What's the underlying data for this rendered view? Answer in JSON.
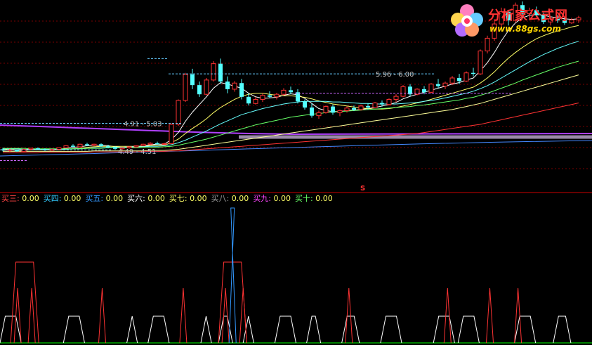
{
  "chart_data": [
    {
      "type": "candlestick",
      "price_labels": [
        "4.91 - 5.03",
        "4.49 - 4.51",
        "5.96 - 6.00"
      ],
      "marker": "S",
      "candles": [
        [
          4.52,
          4.55,
          4.48,
          4.5
        ],
        [
          4.5,
          4.53,
          4.47,
          4.51
        ],
        [
          4.51,
          4.52,
          4.47,
          4.48
        ],
        [
          4.48,
          4.53,
          4.47,
          4.52
        ],
        [
          4.52,
          4.55,
          4.5,
          4.54
        ],
        [
          4.54,
          4.56,
          4.51,
          4.52
        ],
        [
          4.52,
          4.54,
          4.49,
          4.5
        ],
        [
          4.5,
          4.53,
          4.49,
          4.52
        ],
        [
          4.52,
          4.56,
          4.51,
          4.55
        ],
        [
          4.55,
          4.6,
          4.54,
          4.59
        ],
        [
          4.59,
          4.62,
          4.56,
          4.57
        ],
        [
          4.57,
          4.63,
          4.56,
          4.62
        ],
        [
          4.62,
          4.65,
          4.58,
          4.6
        ],
        [
          4.6,
          4.63,
          4.58,
          4.62
        ],
        [
          4.62,
          4.64,
          4.57,
          4.58
        ],
        [
          4.58,
          4.61,
          4.54,
          4.56
        ],
        [
          4.56,
          4.58,
          4.51,
          4.53
        ],
        [
          4.53,
          4.56,
          4.5,
          4.55
        ],
        [
          4.55,
          4.58,
          4.53,
          4.57
        ],
        [
          4.57,
          4.6,
          4.55,
          4.59
        ],
        [
          4.59,
          4.63,
          4.58,
          4.62
        ],
        [
          4.62,
          4.66,
          4.6,
          4.64
        ],
        [
          4.64,
          4.67,
          4.61,
          4.62
        ],
        [
          4.62,
          4.65,
          4.6,
          4.63
        ],
        [
          4.63,
          5.03,
          4.62,
          5.01
        ],
        [
          5.01,
          5.5,
          4.98,
          5.48
        ],
        [
          5.48,
          6.02,
          5.45,
          5.99
        ],
        [
          5.99,
          6.1,
          5.7,
          5.78
        ],
        [
          5.78,
          5.85,
          5.55,
          5.6
        ],
        [
          5.6,
          5.92,
          5.58,
          5.88
        ],
        [
          5.88,
          6.25,
          5.85,
          6.2
        ],
        [
          6.2,
          6.3,
          5.8,
          5.85
        ],
        [
          5.85,
          5.95,
          5.62,
          5.7
        ],
        [
          5.7,
          5.86,
          5.65,
          5.82
        ],
        [
          5.82,
          5.9,
          5.5,
          5.55
        ],
        [
          5.55,
          5.62,
          5.38,
          5.42
        ],
        [
          5.42,
          5.55,
          5.4,
          5.5
        ],
        [
          5.5,
          5.62,
          5.45,
          5.58
        ],
        [
          5.58,
          5.66,
          5.52,
          5.55
        ],
        [
          5.55,
          5.63,
          5.5,
          5.6
        ],
        [
          5.6,
          5.72,
          5.57,
          5.68
        ],
        [
          5.68,
          5.75,
          5.6,
          5.64
        ],
        [
          5.64,
          5.7,
          5.42,
          5.46
        ],
        [
          5.46,
          5.5,
          5.3,
          5.34
        ],
        [
          5.34,
          5.42,
          5.14,
          5.18
        ],
        [
          5.18,
          5.28,
          5.12,
          5.24
        ],
        [
          5.24,
          5.38,
          5.22,
          5.36
        ],
        [
          5.36,
          5.4,
          5.2,
          5.24
        ],
        [
          5.24,
          5.3,
          5.17,
          5.28
        ],
        [
          5.28,
          5.36,
          5.24,
          5.33
        ],
        [
          5.33,
          5.38,
          5.27,
          5.3
        ],
        [
          5.3,
          5.4,
          5.28,
          5.37
        ],
        [
          5.37,
          5.42,
          5.3,
          5.34
        ],
        [
          5.34,
          5.45,
          5.33,
          5.43
        ],
        [
          5.43,
          5.48,
          5.36,
          5.4
        ],
        [
          5.4,
          5.52,
          5.38,
          5.5
        ],
        [
          5.5,
          5.6,
          5.45,
          5.56
        ],
        [
          5.56,
          5.78,
          5.54,
          5.75
        ],
        [
          5.75,
          5.8,
          5.56,
          5.6
        ],
        [
          5.6,
          5.72,
          5.58,
          5.7
        ],
        [
          5.7,
          5.76,
          5.6,
          5.64
        ],
        [
          5.64,
          5.82,
          5.62,
          5.8
        ],
        [
          5.8,
          5.9,
          5.72,
          5.76
        ],
        [
          5.76,
          5.85,
          5.7,
          5.82
        ],
        [
          5.82,
          5.96,
          5.78,
          5.92
        ],
        [
          5.92,
          6.0,
          5.8,
          5.86
        ],
        [
          5.86,
          6.05,
          5.84,
          6.02
        ],
        [
          6.02,
          6.12,
          5.95,
          6.0
        ],
        [
          6.0,
          6.48,
          5.98,
          6.45
        ],
        [
          6.45,
          6.75,
          6.4,
          6.7
        ],
        [
          6.7,
          7.05,
          6.65,
          6.98
        ],
        [
          6.98,
          7.3,
          6.9,
          7.22
        ],
        [
          7.22,
          7.25,
          6.95,
          7.05
        ],
        [
          7.05,
          7.4,
          7.0,
          7.35
        ],
        [
          7.35,
          7.42,
          7.1,
          7.18
        ],
        [
          7.18,
          7.3,
          7.05,
          7.25
        ],
        [
          7.25,
          7.32,
          7.12,
          7.15
        ],
        [
          7.15,
          7.2,
          6.98,
          7.02
        ],
        [
          7.02,
          7.12,
          6.95,
          7.08
        ],
        [
          7.08,
          7.15,
          7.0,
          7.05
        ],
        [
          7.05,
          7.12,
          6.96,
          7.0
        ],
        [
          7.0,
          7.1,
          6.98,
          7.06
        ],
        [
          7.06,
          7.14,
          7.0,
          7.1
        ]
      ],
      "ma_lines": [
        {
          "color": "#ffffff",
          "values": [
            4.5,
            4.51,
            4.5,
            4.5,
            4.51,
            4.52,
            4.51,
            4.51,
            4.52,
            4.54,
            4.56,
            4.57,
            4.59,
            4.6,
            4.6,
            4.59,
            4.57,
            4.56,
            4.56,
            4.57,
            4.59,
            4.61,
            4.62,
            4.62,
            4.71,
            4.85,
            5.07,
            5.25,
            5.4,
            5.55,
            5.72,
            5.83,
            5.8,
            5.76,
            5.72,
            5.62,
            5.55,
            5.52,
            5.53,
            5.54,
            5.58,
            5.61,
            5.59,
            5.52,
            5.42,
            5.32,
            5.28,
            5.26,
            5.26,
            5.28,
            5.29,
            5.3,
            5.32,
            5.34,
            5.37,
            5.4,
            5.44,
            5.51,
            5.56,
            5.6,
            5.64,
            5.68,
            5.72,
            5.76,
            5.8,
            5.83,
            5.88,
            5.92,
            6.06,
            6.22,
            6.42,
            6.65,
            6.85,
            7.0,
            7.1,
            7.15,
            7.17,
            7.15,
            7.12,
            7.1,
            7.08,
            7.07,
            7.08
          ]
        },
        {
          "color": "#ffff66",
          "values": [
            4.52,
            4.52,
            4.51,
            4.51,
            4.51,
            4.51,
            4.51,
            4.51,
            4.51,
            4.52,
            4.53,
            4.54,
            4.56,
            4.57,
            4.58,
            4.58,
            4.58,
            4.58,
            4.58,
            4.58,
            4.58,
            4.59,
            4.6,
            4.6,
            4.65,
            4.72,
            4.83,
            4.93,
            5.02,
            5.12,
            5.24,
            5.34,
            5.42,
            5.5,
            5.56,
            5.6,
            5.62,
            5.62,
            5.6,
            5.58,
            5.57,
            5.57,
            5.56,
            5.54,
            5.51,
            5.47,
            5.44,
            5.41,
            5.39,
            5.37,
            5.35,
            5.33,
            5.32,
            5.31,
            5.31,
            5.32,
            5.34,
            5.37,
            5.4,
            5.43,
            5.46,
            5.5,
            5.54,
            5.58,
            5.62,
            5.66,
            5.7,
            5.74,
            5.82,
            5.92,
            6.04,
            6.18,
            6.31,
            6.42,
            6.52,
            6.61,
            6.69,
            6.75,
            6.8,
            6.84,
            6.88,
            6.92,
            6.95
          ]
        },
        {
          "color": "#66ffff",
          "values": [
            4.53,
            4.53,
            4.53,
            4.52,
            4.52,
            4.52,
            4.52,
            4.52,
            4.52,
            4.52,
            4.53,
            4.53,
            4.54,
            4.55,
            4.55,
            4.56,
            4.56,
            4.56,
            4.57,
            4.57,
            4.57,
            4.58,
            4.58,
            4.59,
            4.61,
            4.65,
            4.7,
            4.76,
            4.82,
            4.88,
            4.95,
            5.02,
            5.08,
            5.14,
            5.2,
            5.24,
            5.28,
            5.32,
            5.35,
            5.38,
            5.41,
            5.43,
            5.45,
            5.46,
            5.46,
            5.46,
            5.46,
            5.45,
            5.45,
            5.44,
            5.43,
            5.42,
            5.42,
            5.41,
            5.41,
            5.41,
            5.41,
            5.42,
            5.43,
            5.44,
            5.46,
            5.48,
            5.5,
            5.53,
            5.56,
            5.59,
            5.62,
            5.66,
            5.71,
            5.77,
            5.84,
            5.92,
            6.0,
            6.08,
            6.16,
            6.24,
            6.31,
            6.38,
            6.44,
            6.5,
            6.55,
            6.6,
            6.64
          ]
        },
        {
          "color": "#66ff66",
          "values": [
            4.54,
            4.54,
            4.54,
            4.54,
            4.53,
            4.53,
            4.53,
            4.53,
            4.53,
            4.53,
            4.53,
            4.53,
            4.54,
            4.54,
            4.54,
            4.55,
            4.55,
            4.55,
            4.55,
            4.55,
            4.56,
            4.56,
            4.56,
            4.57,
            4.58,
            4.6,
            4.63,
            4.66,
            4.69,
            4.72,
            4.76,
            4.8,
            4.84,
            4.88,
            4.92,
            4.96,
            5.0,
            5.03,
            5.06,
            5.09,
            5.12,
            5.15,
            5.17,
            5.19,
            5.21,
            5.22,
            5.24,
            5.25,
            5.26,
            5.27,
            5.28,
            5.29,
            5.3,
            5.31,
            5.32,
            5.33,
            5.34,
            5.35,
            5.36,
            5.38,
            5.39,
            5.41,
            5.43,
            5.45,
            5.47,
            5.49,
            5.52,
            5.54,
            5.58,
            5.62,
            5.67,
            5.72,
            5.77,
            5.82,
            5.88,
            5.93,
            5.98,
            6.03,
            6.08,
            6.13,
            6.17,
            6.21,
            6.25
          ]
        },
        {
          "color": "#ffff99",
          "values": [
            4.48,
            4.48,
            4.48,
            4.48,
            4.48,
            4.48,
            4.48,
            4.48,
            4.48,
            4.48,
            4.48,
            4.48,
            4.48,
            4.49,
            4.49,
            4.49,
            4.49,
            4.49,
            4.49,
            4.49,
            4.49,
            4.5,
            4.5,
            4.5,
            4.51,
            4.52,
            4.54,
            4.56,
            4.58,
            4.6,
            4.62,
            4.64,
            4.66,
            4.68,
            4.7,
            4.72,
            4.74,
            4.76,
            4.78,
            4.8,
            4.82,
            4.84,
            4.86,
            4.88,
            4.9,
            4.92,
            4.94,
            4.96,
            4.98,
            5.0,
            5.02,
            5.04,
            5.06,
            5.08,
            5.1,
            5.12,
            5.14,
            5.16,
            5.18,
            5.2,
            5.22,
            5.24,
            5.26,
            5.28,
            5.3,
            5.33,
            5.36,
            5.39,
            5.42,
            5.46,
            5.5,
            5.54,
            5.58,
            5.62,
            5.66,
            5.7,
            5.74,
            5.78,
            5.82,
            5.86,
            5.9,
            5.94,
            5.98
          ]
        },
        {
          "color": "#ff3333",
          "values": [
            4.45,
            4.45,
            4.45,
            4.45,
            4.45,
            4.45,
            4.46,
            4.46,
            4.46,
            4.46,
            4.46,
            4.46,
            4.46,
            4.47,
            4.47,
            4.47,
            4.47,
            4.47,
            4.47,
            4.47,
            4.48,
            4.48,
            4.48,
            4.48,
            4.49,
            4.49,
            4.5,
            4.51,
            4.52,
            4.53,
            4.54,
            4.55,
            4.56,
            4.57,
            4.58,
            4.59,
            4.6,
            4.61,
            4.62,
            4.63,
            4.64,
            4.65,
            4.66,
            4.67,
            4.68,
            4.69,
            4.7,
            4.71,
            4.72,
            4.73,
            4.74,
            4.75,
            4.76,
            4.77,
            4.78,
            4.79,
            4.8,
            4.81,
            4.82,
            4.83,
            4.85,
            4.87,
            4.89,
            4.91,
            4.93,
            4.95,
            4.97,
            4.99,
            5.01,
            5.04,
            5.07,
            5.1,
            5.13,
            5.16,
            5.19,
            5.22,
            5.25,
            5.28,
            5.31,
            5.34,
            5.37,
            5.4,
            5.43
          ]
        }
      ]
    },
    {
      "type": "indicator",
      "legend": [
        {
          "label": "买三:",
          "value": "0.00",
          "color": "#ff4444"
        },
        {
          "label": "买四:",
          "value": "0.00",
          "color": "#33ccff"
        },
        {
          "label": "买五:",
          "value": "0.00",
          "color": "#3399ff"
        },
        {
          "label": "买六:",
          "value": "0.00",
          "color": "#ffffff"
        },
        {
          "label": "买七:",
          "value": "0.00",
          "color": "#ffff66"
        },
        {
          "label": "买八:",
          "value": "0.00",
          "color": "#999999"
        },
        {
          "label": "买九:",
          "value": "0.00",
          "color": "#ff44ff"
        },
        {
          "label": "买十:",
          "value": "0.00",
          "color": "#66ff66"
        }
      ],
      "white_signals": [
        [
          0,
          6
        ],
        [
          18,
          24
        ],
        [
          36,
          39
        ],
        [
          42,
          48
        ],
        [
          57,
          60
        ],
        [
          62,
          66
        ],
        [
          69,
          72
        ],
        [
          78,
          84
        ],
        [
          87,
          91
        ],
        [
          97,
          102
        ],
        [
          108,
          114
        ],
        [
          123,
          129
        ],
        [
          130,
          136
        ],
        [
          146,
          152
        ],
        [
          157,
          162
        ]
      ],
      "red_wide_signals": [
        [
          3,
          11
        ],
        [
          62,
          70
        ]
      ],
      "red_spike_signals": [
        [
          4,
          6
        ],
        [
          8,
          10
        ],
        [
          28,
          30
        ],
        [
          51,
          53
        ],
        [
          63,
          65
        ],
        [
          68,
          70
        ],
        [
          98,
          100
        ],
        [
          126,
          128
        ],
        [
          138,
          140
        ],
        [
          146,
          148
        ]
      ],
      "blue_spike_signals": [
        [
          65,
          67
        ]
      ]
    }
  ],
  "logo": {
    "name": "分析家公式网",
    "url": "www.88gs.com"
  }
}
